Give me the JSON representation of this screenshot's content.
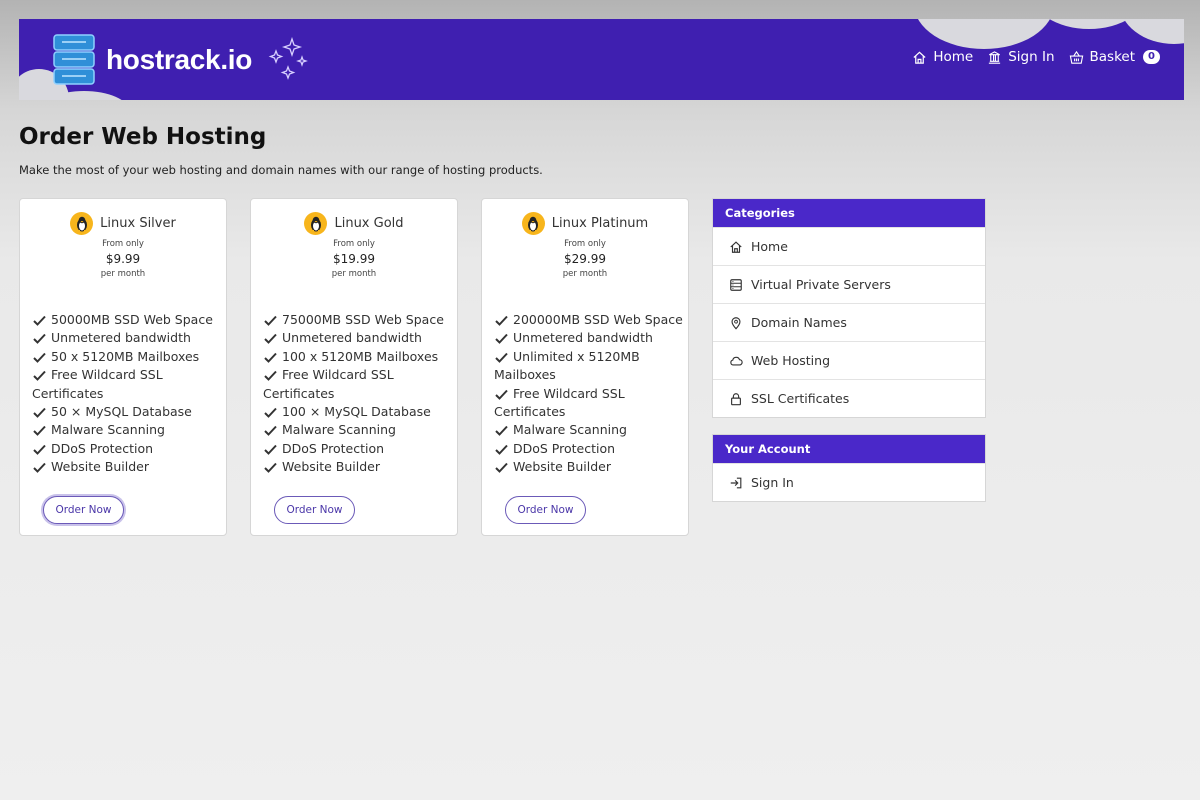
{
  "brand": {
    "name": "hostrack.io",
    "colors": {
      "header": "#3f1fb0",
      "accent": "#4a28c9",
      "tux": "#f7b51c"
    }
  },
  "nav": [
    {
      "icon": "home-icon",
      "label": "Home"
    },
    {
      "icon": "bank-icon",
      "label": "Sign In"
    },
    {
      "icon": "basket-icon",
      "label": "Basket",
      "badge": "0"
    }
  ],
  "page": {
    "title": "Order Web Hosting",
    "subtitle": "Make the most of your web hosting and domain names with our range of hosting products."
  },
  "products": [
    {
      "name": "Linux Silver",
      "from": "From only",
      "price": "$9.99",
      "period": "per month",
      "features": [
        "50000MB SSD Web Space",
        "Unmetered bandwidth",
        "50 x 5120MB Mailboxes",
        "Free Wildcard SSL Certificates",
        "50 × MySQL Database",
        "Malware Scanning",
        "DDoS Protection",
        "Website Builder"
      ],
      "button": "Order Now"
    },
    {
      "name": "Linux Gold",
      "from": "From only",
      "price": "$19.99",
      "period": "per month",
      "features": [
        "75000MB SSD Web Space",
        "Unmetered bandwidth",
        "100 x 5120MB Mailboxes",
        "Free Wildcard SSL Certificates",
        "100 × MySQL Database",
        "Malware Scanning",
        "DDoS Protection",
        "Website Builder"
      ],
      "button": "Order Now"
    },
    {
      "name": "Linux Platinum",
      "from": "From only",
      "price": "$29.99",
      "period": "per month",
      "features": [
        "200000MB SSD Web Space",
        "Unmetered bandwidth",
        "Unlimited x 5120MB Mailboxes",
        "Free Wildcard SSL Certificates",
        "Malware Scanning",
        "DDoS Protection",
        "Website Builder"
      ],
      "button": "Order Now"
    }
  ],
  "categories": {
    "title": "Categories",
    "items": [
      {
        "icon": "home-icon",
        "label": "Home"
      },
      {
        "icon": "server-icon",
        "label": "Virtual Private Servers"
      },
      {
        "icon": "map-pin-icon",
        "label": "Domain Names"
      },
      {
        "icon": "cloud-icon",
        "label": "Web Hosting"
      },
      {
        "icon": "lock-icon",
        "label": "SSL Certificates"
      }
    ]
  },
  "account": {
    "title": "Your Account",
    "items": [
      {
        "icon": "sign-in-icon",
        "label": "Sign In"
      }
    ]
  }
}
